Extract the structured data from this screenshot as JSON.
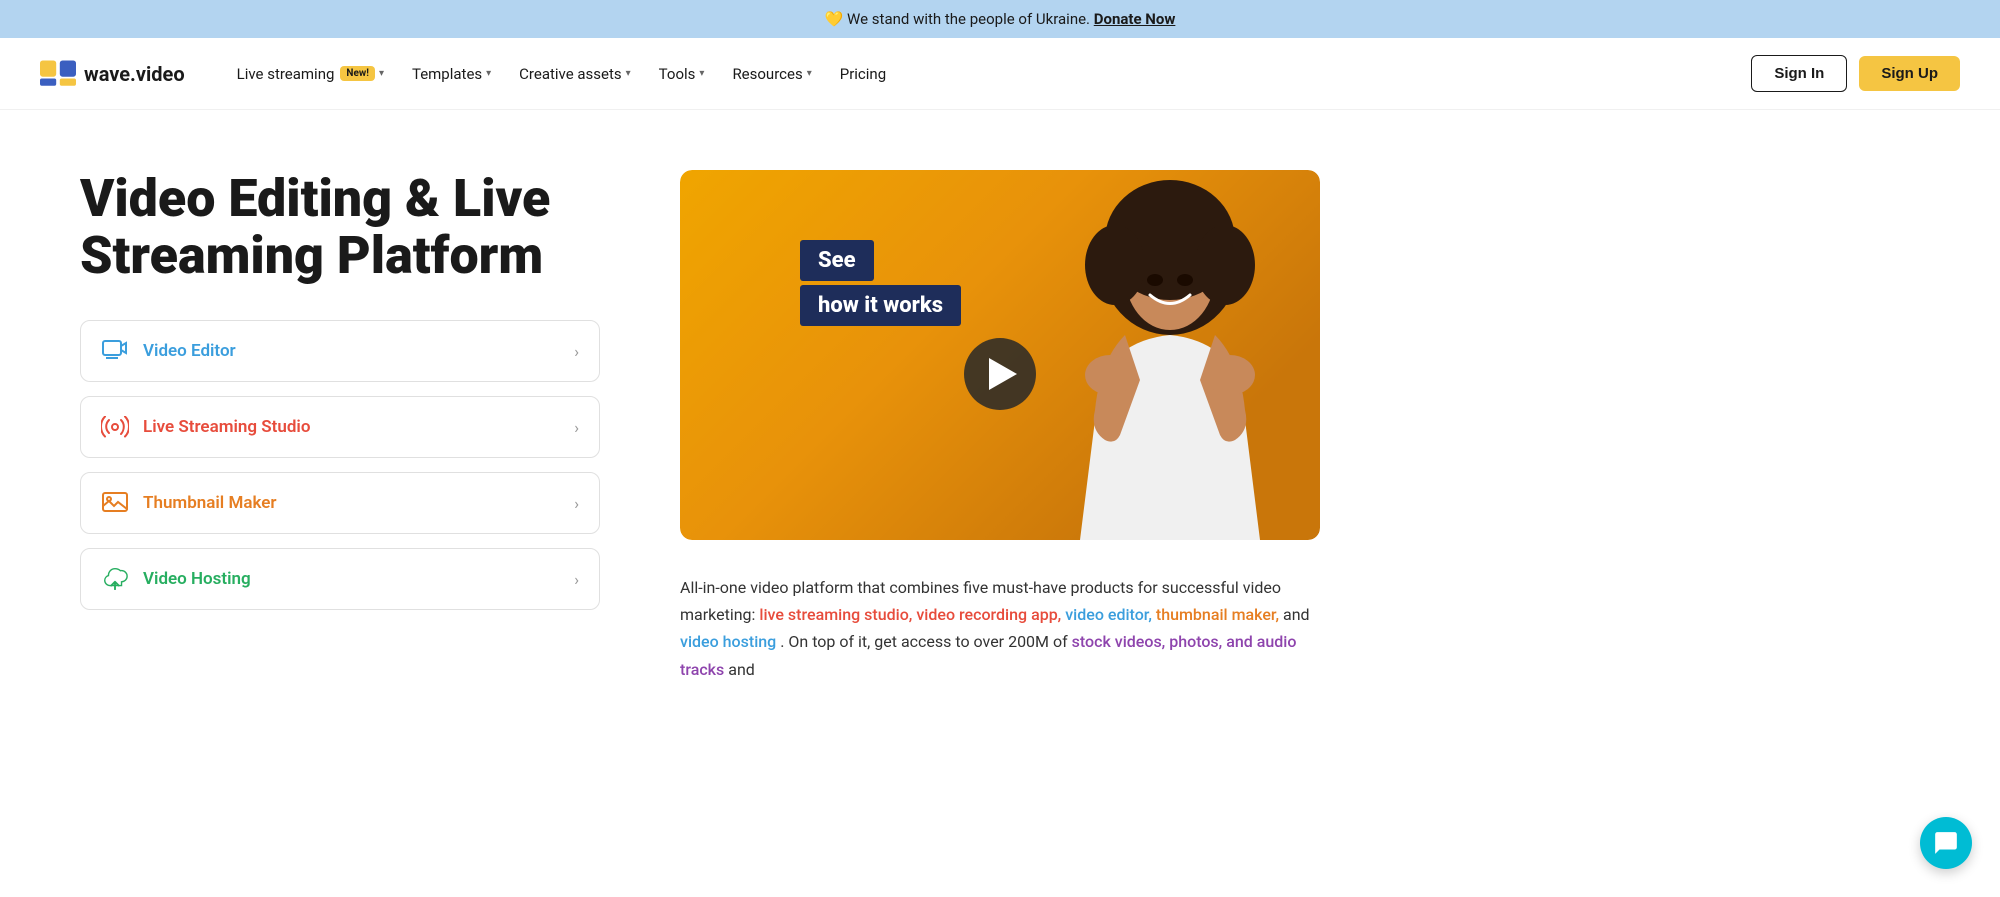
{
  "banner": {
    "heart": "💛",
    "text": "We stand with the people of Ukraine.",
    "link_text": "Donate Now"
  },
  "nav": {
    "logo_text": "wave.video",
    "items": [
      {
        "id": "live-streaming",
        "label": "Live streaming",
        "badge": "New!",
        "has_dropdown": true
      },
      {
        "id": "templates",
        "label": "Templates",
        "has_dropdown": true
      },
      {
        "id": "creative-assets",
        "label": "Creative assets",
        "has_dropdown": true
      },
      {
        "id": "tools",
        "label": "Tools",
        "has_dropdown": true
      },
      {
        "id": "resources",
        "label": "Resources",
        "has_dropdown": true
      },
      {
        "id": "pricing",
        "label": "Pricing",
        "has_dropdown": false
      }
    ],
    "signin_label": "Sign In",
    "signup_label": "Sign Up"
  },
  "hero": {
    "title": "Video Editing & Live Streaming Platform",
    "features": [
      {
        "id": "video-editor",
        "label": "Video Editor",
        "color": "blue"
      },
      {
        "id": "live-streaming-studio",
        "label": "Live Streaming Studio",
        "color": "red"
      },
      {
        "id": "thumbnail-maker",
        "label": "Thumbnail Maker",
        "color": "orange"
      },
      {
        "id": "video-hosting",
        "label": "Video Hosting",
        "color": "green"
      }
    ],
    "video": {
      "badge_line1": "See",
      "badge_line2": "how it works"
    },
    "description": "All-in-one video platform that combines five must-have products for successful video marketing: ",
    "desc_links": [
      {
        "text": "live streaming studio, video recording app,",
        "color": "red"
      },
      {
        "text": "video editor,",
        "color": "blue"
      },
      {
        "text": "thumbnail maker,",
        "color": "orange"
      },
      {
        "text": "and",
        "color": "plain"
      },
      {
        "text": "video hosting",
        "color": "blue"
      },
      {
        "text": ". On top of it, get access to over 200M of",
        "color": "plain"
      },
      {
        "text": "stock videos, photos, and audio tracks",
        "color": "purple"
      },
      {
        "text": "and",
        "color": "plain"
      }
    ]
  }
}
